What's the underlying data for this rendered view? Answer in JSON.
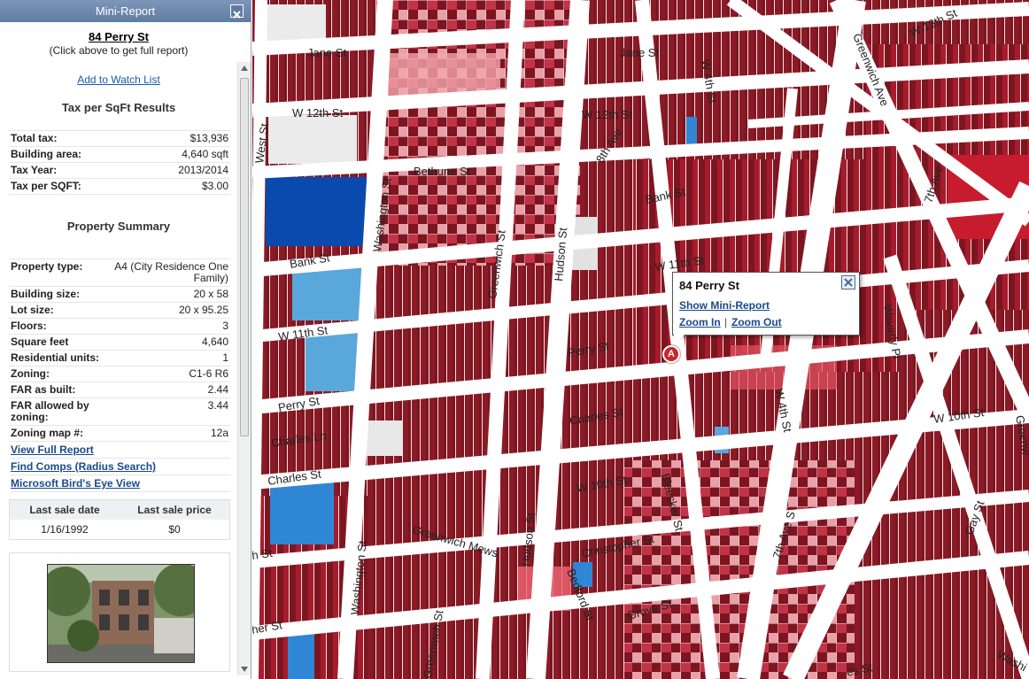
{
  "panel": {
    "title": "Mini-Report",
    "address": "84 Perry St",
    "address_hint": "(Click above to get full report)",
    "watch_link": "Add to Watch List",
    "tax_title": "Tax per SqFt Results",
    "tax_rows": [
      {
        "k": "Total tax:",
        "v": "$13,936"
      },
      {
        "k": "Building area:",
        "v": "4,640 sqft"
      },
      {
        "k": "Tax Year:",
        "v": "2013/2014"
      },
      {
        "k": "Tax per SQFT:",
        "v": "$3.00"
      }
    ],
    "summary_title": "Property Summary",
    "summary_rows": [
      {
        "k": "Property type:",
        "v": "A4 (City Residence One Family)"
      },
      {
        "k": "Building size:",
        "v": "20 x 58"
      },
      {
        "k": "Lot size:",
        "v": "20 x 95.25"
      },
      {
        "k": "Floors:",
        "v": "3"
      },
      {
        "k": "Square feet",
        "v": "4,640"
      },
      {
        "k": "Residential units:",
        "v": "1"
      },
      {
        "k": "Zoning:",
        "v": "C1-6 R6"
      },
      {
        "k": "FAR as built:",
        "v": "2.44"
      },
      {
        "k": "FAR allowed by zoning:",
        "v": "3.44"
      },
      {
        "k": "Zoning map #:",
        "v": "12a"
      }
    ],
    "links": [
      "View Full Report",
      "Find Comps (Radius Search)",
      "Microsoft Bird's Eye View"
    ],
    "sale_headers": [
      "Last sale date",
      "Last sale price"
    ],
    "sale_values": [
      "1/16/1992",
      "$0"
    ]
  },
  "popup": {
    "title": "84 Perry St",
    "show_link": "Show Mini-Report",
    "zoom_in": "Zoom In",
    "separator": "|",
    "zoom_out": "Zoom Out"
  },
  "marker": {
    "label": "A"
  },
  "streets": [
    "Jane St",
    "Jane St",
    "W 13th St",
    "Greenwich Ave",
    "W 4th St",
    "W 12th St",
    "W 12th St",
    "West St",
    "Bethune St",
    "8th Ave",
    "Bank St",
    "7th Ave",
    "Washington St",
    "Greenwich St",
    "Hudson St",
    "Bank St",
    "W 11th St",
    "W 11th St",
    "Waverly Pl",
    "Perry St",
    "Perry St",
    "Charles Ln",
    "Charles St",
    "Charles St",
    "W 4th St",
    "W 10th St",
    "W 10th St",
    "Greenwich Mews",
    "Bleecker St",
    "Christopher St",
    "7th Ave S",
    "Gay St",
    "Hudson St",
    "Washington St",
    "Bedford St",
    "Grove St",
    "Greenwich St",
    "Greenw",
    "h St",
    "her St",
    "es St",
    "Washi"
  ],
  "colors": {
    "panel_header": "#6a86ad",
    "link": "#1a4a8a",
    "parcel_dark": "#7b1620",
    "parcel_red": "#b01d2e",
    "parcel_pink": "#f3a6ad",
    "parcel_blue": "#5aa7dc",
    "parcel_darkblue": "#0a4aae",
    "marker": "#c62828"
  }
}
